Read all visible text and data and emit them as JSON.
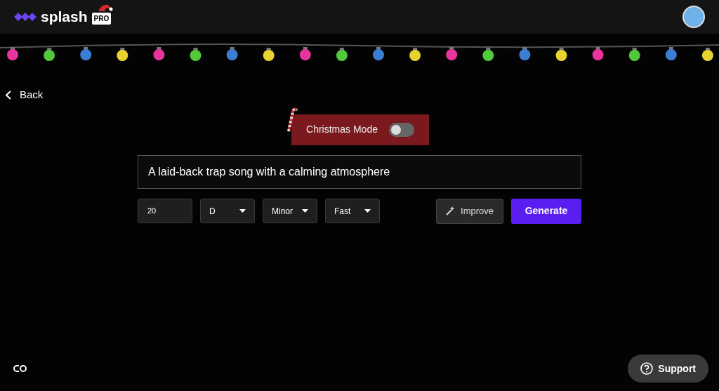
{
  "header": {
    "logo_text": "splash",
    "badge": "PRO"
  },
  "back": {
    "label": "Back"
  },
  "christmas_mode": {
    "label": "Christmas Mode",
    "on": false
  },
  "prompt": {
    "value": "A laid-back trap song with a calming atmosphere"
  },
  "controls": [
    {
      "kind": "input",
      "value": "20"
    },
    {
      "kind": "select",
      "value": "D"
    },
    {
      "kind": "select",
      "value": "Minor"
    },
    {
      "kind": "select",
      "value": "Fast"
    }
  ],
  "improve_button": "Improve",
  "generate_button": "Generate",
  "support_button": "Support"
}
